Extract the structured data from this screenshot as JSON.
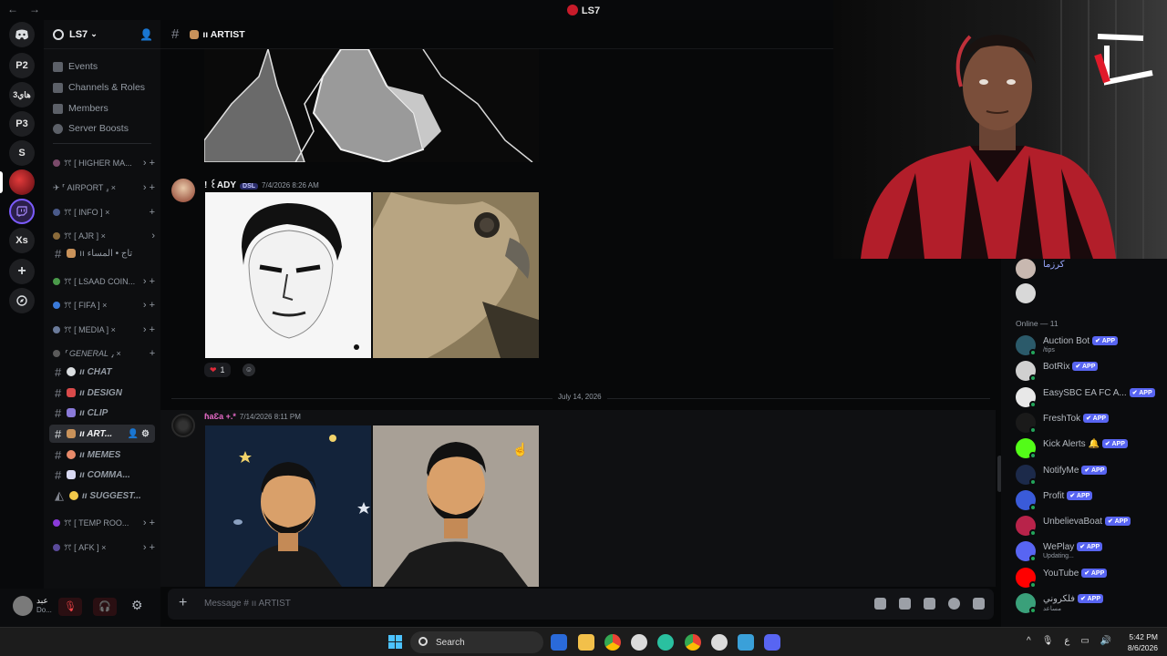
{
  "window": {
    "title": "LS7",
    "back": "←",
    "forward": "→"
  },
  "rail": {
    "servers": [
      "P2",
      "هاي3",
      "P3",
      "S",
      "Xs"
    ]
  },
  "server": {
    "name": "LS7",
    "menu": [
      "Events",
      "Channels & Roles",
      "Members",
      "Server Boosts"
    ],
    "categories": [
      "ꔫ [ HIGHER MA...",
      "✈ ⸢ AIRPORT ⸥ ×",
      "ꔫ [ INFO ] ×",
      "ꔫ [ AJR ] ×",
      "ꔫ [ LSAAD COIN...",
      "ꔫ [ FIFA ] ×",
      "ꔫ [ MEDIA ] ×",
      "⸢ GENERAL ⸥ ×",
      "ꔫ [ TEMP ROO...",
      "ꔫ [ AFK ] ×"
    ],
    "channels": [
      "ıı تاج • المساء",
      "ıı CHAT",
      "ıı DESIGN",
      "ıı CLIP",
      "ıı ART...",
      "ıı MEMES",
      "ıı COMMA...",
      "ıı SUGGEST..."
    ]
  },
  "channel": {
    "name": "ıı ARTIST",
    "composer_placeholder": "Message # ıı ARTIST"
  },
  "messages": [
    {
      "author": "! ꒰ADY",
      "tag": "DSL",
      "time": "7/4/2026 8:26 AM",
      "reaction_count": "1"
    },
    {
      "author": "ɦaƐa +.*",
      "time": "7/14/2026 8:11 PM"
    }
  ],
  "date_divider": "July 14, 2026",
  "user": {
    "name": "عبد",
    "status": "Do..."
  },
  "members": {
    "top": [
      {
        "name": "كرزما"
      },
      {
        "name": ""
      }
    ],
    "online_header": "Online — 11",
    "online": [
      {
        "name": "Auction Bot",
        "badge": "✔ APP",
        "sub": "/tips",
        "color": "#2b5a6a"
      },
      {
        "name": "BotRix",
        "badge": "✔ APP",
        "sub": "",
        "color": "#d0d0d0"
      },
      {
        "name": "EasySBC EA FC A...",
        "badge": "✔ APP",
        "sub": "",
        "color": "#e8e8e8"
      },
      {
        "name": "FreshTok",
        "badge": "✔ APP",
        "sub": "",
        "color": "#1a1a1a"
      },
      {
        "name": "Kick Alerts 🔔",
        "badge": "✔ APP",
        "sub": "",
        "color": "#53fc18"
      },
      {
        "name": "NotifyMe",
        "badge": "✔ APP",
        "sub": "",
        "color": "#1c2a4a"
      },
      {
        "name": "Profit",
        "badge": "✔ APP",
        "sub": "",
        "color": "#3a5bd9"
      },
      {
        "name": "UnbelievaBoat",
        "badge": "✔ APP",
        "sub": "",
        "color": "#b8234a"
      },
      {
        "name": "WePlay",
        "badge": "✔ APP",
        "sub": "Updating...",
        "color": "#5865f2"
      },
      {
        "name": "YouTube",
        "badge": "✔ APP",
        "sub": "",
        "color": "#ff0000"
      },
      {
        "name": "فلكروني",
        "badge": "✔ APP",
        "sub": "مساعد",
        "color": "#3aa07a"
      }
    ]
  },
  "taskbar": {
    "search": "Search",
    "time": "5:42 PM",
    "date": "8/6/2026",
    "lang": "ع"
  },
  "colors": {
    "accent": "#5865f2",
    "online": "#23a55a",
    "danger": "#ed4245"
  }
}
